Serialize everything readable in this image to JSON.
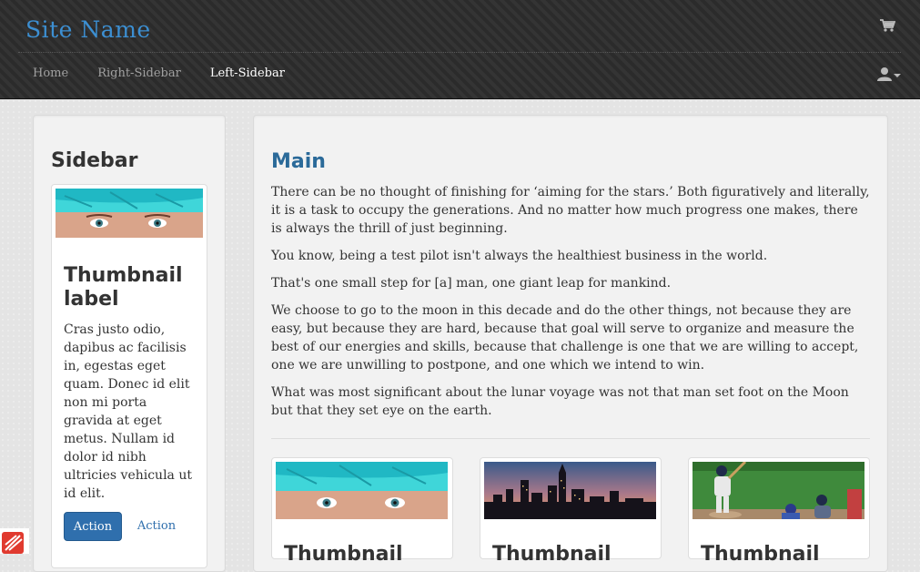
{
  "navbar": {
    "brand": "Site Name",
    "links": [
      "Home",
      "Right-Sidebar",
      "Left-Sidebar"
    ],
    "active_link": "Left-Sidebar",
    "icons": {
      "cart": "cart-icon",
      "user": "user-icon"
    }
  },
  "sidebar": {
    "title": "Sidebar",
    "thumbnail": {
      "title": "Thumbnail label",
      "text": "Cras justo odio, dapibus ac facilisis in, egestas eget quam. Donec id elit non mi porta gravida at eget metus. Nullam id dolor id nibh ultricies vehicula ut id elit.",
      "primary_button": "Action",
      "secondary_button": "Action"
    }
  },
  "main": {
    "title": "Main",
    "paragraphs": [
      "There can be no thought of finishing for ‘aiming for the stars.’ Both figuratively and literally, it is a task to occupy the generations. And no matter how much progress one makes, there is always the thrill of just beginning.",
      "You know, being a test pilot isn't always the healthiest business in the world.",
      "That's one small step for [a] man, one giant leap for mankind.",
      "We choose to go to the moon in this decade and do the other things, not because they are easy, but because they are hard, because that goal will serve to organize and measure the best of our energies and skills, because that challenge is one that we are willing to accept, one we are unwilling to postpone, and one which we intend to win.",
      "What was most significant about the lunar voyage was not that man set foot on the Moon but that they set eye on the earth."
    ],
    "thumbnails": [
      {
        "title": "Thumbnail",
        "image": "woman-with-turquoise-headscarf"
      },
      {
        "title": "Thumbnail",
        "image": "city-skyline-at-sunset"
      },
      {
        "title": "Thumbnail",
        "image": "baseball-batter"
      }
    ]
  },
  "colors": {
    "brand": "#3c8fd2",
    "heading": "#2b6a99",
    "primary": "#2f6fad",
    "navbar": "#2d2d2d"
  }
}
